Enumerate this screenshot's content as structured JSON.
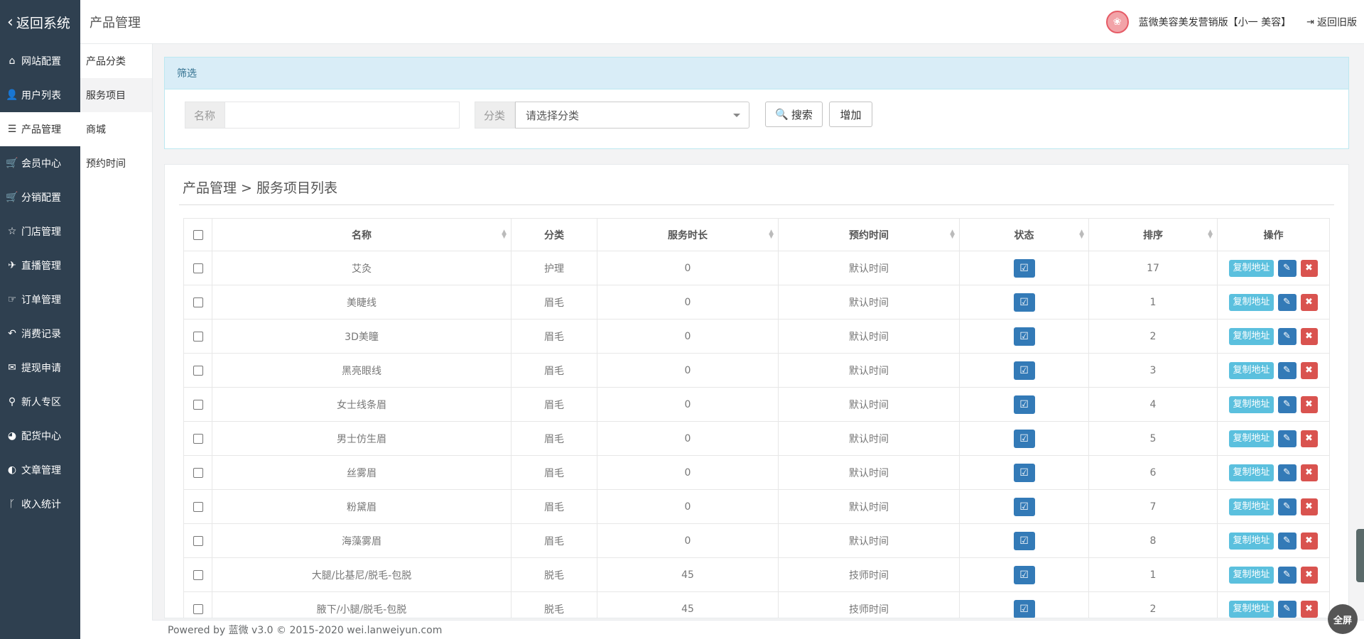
{
  "nav": {
    "back_label": "返回系统",
    "items": [
      {
        "label": "网站配置",
        "icon": "home-icon",
        "glyph": "⌂"
      },
      {
        "label": "用户列表",
        "icon": "user-icon",
        "glyph": "👤"
      },
      {
        "label": "产品管理",
        "icon": "list-icon",
        "glyph": "☰"
      },
      {
        "label": "会员中心",
        "icon": "cart-icon",
        "glyph": "🛒"
      },
      {
        "label": "分销配置",
        "icon": "cart-icon",
        "glyph": "🛒"
      },
      {
        "label": "门店管理",
        "icon": "star-icon",
        "glyph": "☆"
      },
      {
        "label": "直播管理",
        "icon": "plane-icon",
        "glyph": "✈"
      },
      {
        "label": "订单管理",
        "icon": "hand-icon",
        "glyph": "☞"
      },
      {
        "label": "消费记录",
        "icon": "reply-icon",
        "glyph": "↶"
      },
      {
        "label": "提现申请",
        "icon": "wechat-icon",
        "glyph": "✉"
      },
      {
        "label": "新人专区",
        "icon": "map-marker-icon",
        "glyph": "⚲"
      },
      {
        "label": "配货中心",
        "icon": "pie-chart-icon",
        "glyph": "◕"
      },
      {
        "label": "文章管理",
        "icon": "adjust-icon",
        "glyph": "◐"
      },
      {
        "label": "收入统计",
        "icon": "branch-icon",
        "glyph": "ᚴ"
      }
    ]
  },
  "subnav": {
    "title": "产品管理",
    "items": [
      "产品分类",
      "服务项目",
      "商城",
      "预约时间"
    ]
  },
  "header": {
    "shop": "蓝微美容美发营销版【小一 美容】",
    "old_version": "返回旧版"
  },
  "filter": {
    "title": "筛选",
    "name_label": "名称",
    "name_value": "",
    "category_label": "分类",
    "category_value": "请选择分类",
    "search_button": "搜索",
    "add_button": "增加"
  },
  "list": {
    "breadcrumb": "产品管理 > 服务项目列表",
    "columns": [
      "名称",
      "分类",
      "服务时长",
      "预约时间",
      "状态",
      "排序",
      "操作"
    ],
    "copy_label": "复制地址",
    "rows": [
      {
        "name": "艾灸",
        "category": "护理",
        "duration": "0",
        "time": "默认时间",
        "sort": "17"
      },
      {
        "name": "美睫线",
        "category": "眉毛",
        "duration": "0",
        "time": "默认时间",
        "sort": "1"
      },
      {
        "name": "3D美瞳",
        "category": "眉毛",
        "duration": "0",
        "time": "默认时间",
        "sort": "2"
      },
      {
        "name": "黑亮眼线",
        "category": "眉毛",
        "duration": "0",
        "time": "默认时间",
        "sort": "3"
      },
      {
        "name": "女士线条眉",
        "category": "眉毛",
        "duration": "0",
        "time": "默认时间",
        "sort": "4"
      },
      {
        "name": "男士仿生眉",
        "category": "眉毛",
        "duration": "0",
        "time": "默认时间",
        "sort": "5"
      },
      {
        "name": "丝雾眉",
        "category": "眉毛",
        "duration": "0",
        "time": "默认时间",
        "sort": "6"
      },
      {
        "name": "粉黛眉",
        "category": "眉毛",
        "duration": "0",
        "time": "默认时间",
        "sort": "7"
      },
      {
        "name": "海藻雾眉",
        "category": "眉毛",
        "duration": "0",
        "time": "默认时间",
        "sort": "8"
      },
      {
        "name": "大腿/比基尼/脱毛-包脱",
        "category": "脱毛",
        "duration": "45",
        "time": "技师时间",
        "sort": "1"
      },
      {
        "name": "腋下/小腿/脱毛-包脱",
        "category": "脱毛",
        "duration": "45",
        "time": "技师时间",
        "sort": "2"
      }
    ]
  },
  "footer": {
    "text": "Powered by 蓝微 v3.0 © 2015-2020 wei.lanweiyun.com",
    "fullscreen": "全屏"
  }
}
